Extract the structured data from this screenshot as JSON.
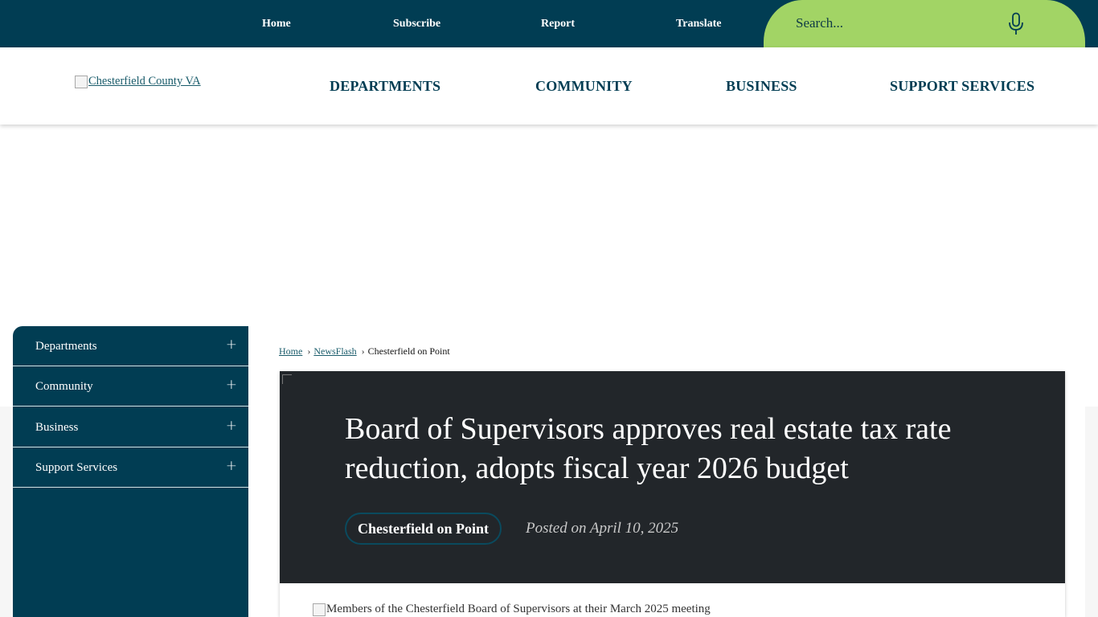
{
  "topbar": {
    "links": [
      "Home",
      "Subscribe",
      "Report",
      "Translate"
    ],
    "search_placeholder": "Search...",
    "mic_icon": "microphone-icon"
  },
  "header": {
    "logo_alt": "Chesterfield County VA",
    "nav": [
      "DEPARTMENTS",
      "COMMUNITY",
      "BUSINESS",
      "SUPPORT SERVICES"
    ]
  },
  "sidebar": {
    "items": [
      {
        "label": "Departments",
        "toggle": "+"
      },
      {
        "label": "Community",
        "toggle": "+"
      },
      {
        "label": "Business",
        "toggle": "+"
      },
      {
        "label": "Support Services",
        "toggle": "+"
      }
    ]
  },
  "breadcrumb": {
    "home": "Home",
    "sep1": "›",
    "newsflash": "NewsFlash",
    "sep2": "›",
    "current": "Chesterfield on Point"
  },
  "article": {
    "title": "Board of Supervisors approves real estate tax rate reduction, adopts fiscal year 2026 budget",
    "category": "Chesterfield on Point",
    "posted": "Posted on April 10, 2025",
    "image_alt": "Members of the Chesterfield Board of Supervisors at their March 2025 meeting"
  },
  "colors": {
    "navy": "#013d53",
    "lime": "#a2d465",
    "hero_bg": "#22262a"
  }
}
